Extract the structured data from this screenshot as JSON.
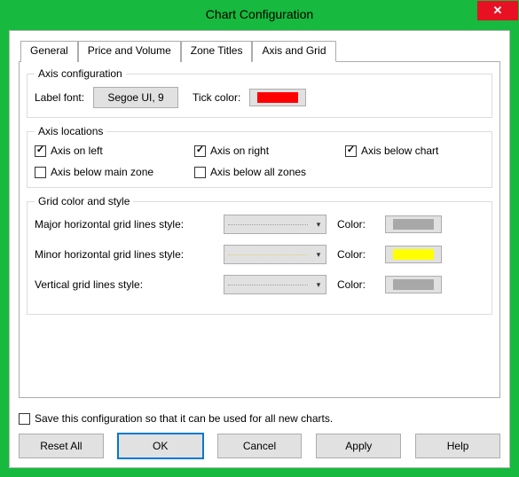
{
  "window": {
    "title": "Chart Configuration",
    "close_glyph": "✕"
  },
  "tabs": [
    {
      "label": "General"
    },
    {
      "label": "Price and Volume"
    },
    {
      "label": "Zone Titles"
    },
    {
      "label": "Axis and Grid"
    }
  ],
  "axis_config": {
    "legend": "Axis configuration",
    "label_font_label": "Label font:",
    "label_font_value": "Segoe UI, 9",
    "tick_color_label": "Tick color:",
    "tick_color": "#ff0000"
  },
  "axis_locations": {
    "legend": "Axis locations",
    "items": [
      {
        "label": "Axis on left",
        "checked": true
      },
      {
        "label": "Axis on right",
        "checked": true
      },
      {
        "label": "Axis below chart",
        "checked": true
      },
      {
        "label": "Axis below main zone",
        "checked": false
      },
      {
        "label": "Axis below all zones",
        "checked": false
      }
    ]
  },
  "grid_style": {
    "legend": "Grid color and style",
    "rows": [
      {
        "label": "Major horizontal grid lines style:",
        "line_style": "dotted",
        "line_color": "#a0a0a0",
        "color_label": "Color:",
        "swatch": "#a8a8a8"
      },
      {
        "label": "Minor horizontal grid lines style:",
        "line_style": "dotted",
        "line_color": "#d9d36a",
        "color_label": "Color:",
        "swatch": "#ffff00"
      },
      {
        "label": "Vertical grid lines style:",
        "line_style": "dotted",
        "line_color": "#a0a0a0",
        "color_label": "Color:",
        "swatch": "#a8a8a8"
      }
    ]
  },
  "save_config": {
    "label": "Save this configuration so that it can be used for all new charts.",
    "checked": false
  },
  "buttons": {
    "reset": "Reset All",
    "ok": "OK",
    "cancel": "Cancel",
    "apply": "Apply",
    "help": "Help"
  }
}
